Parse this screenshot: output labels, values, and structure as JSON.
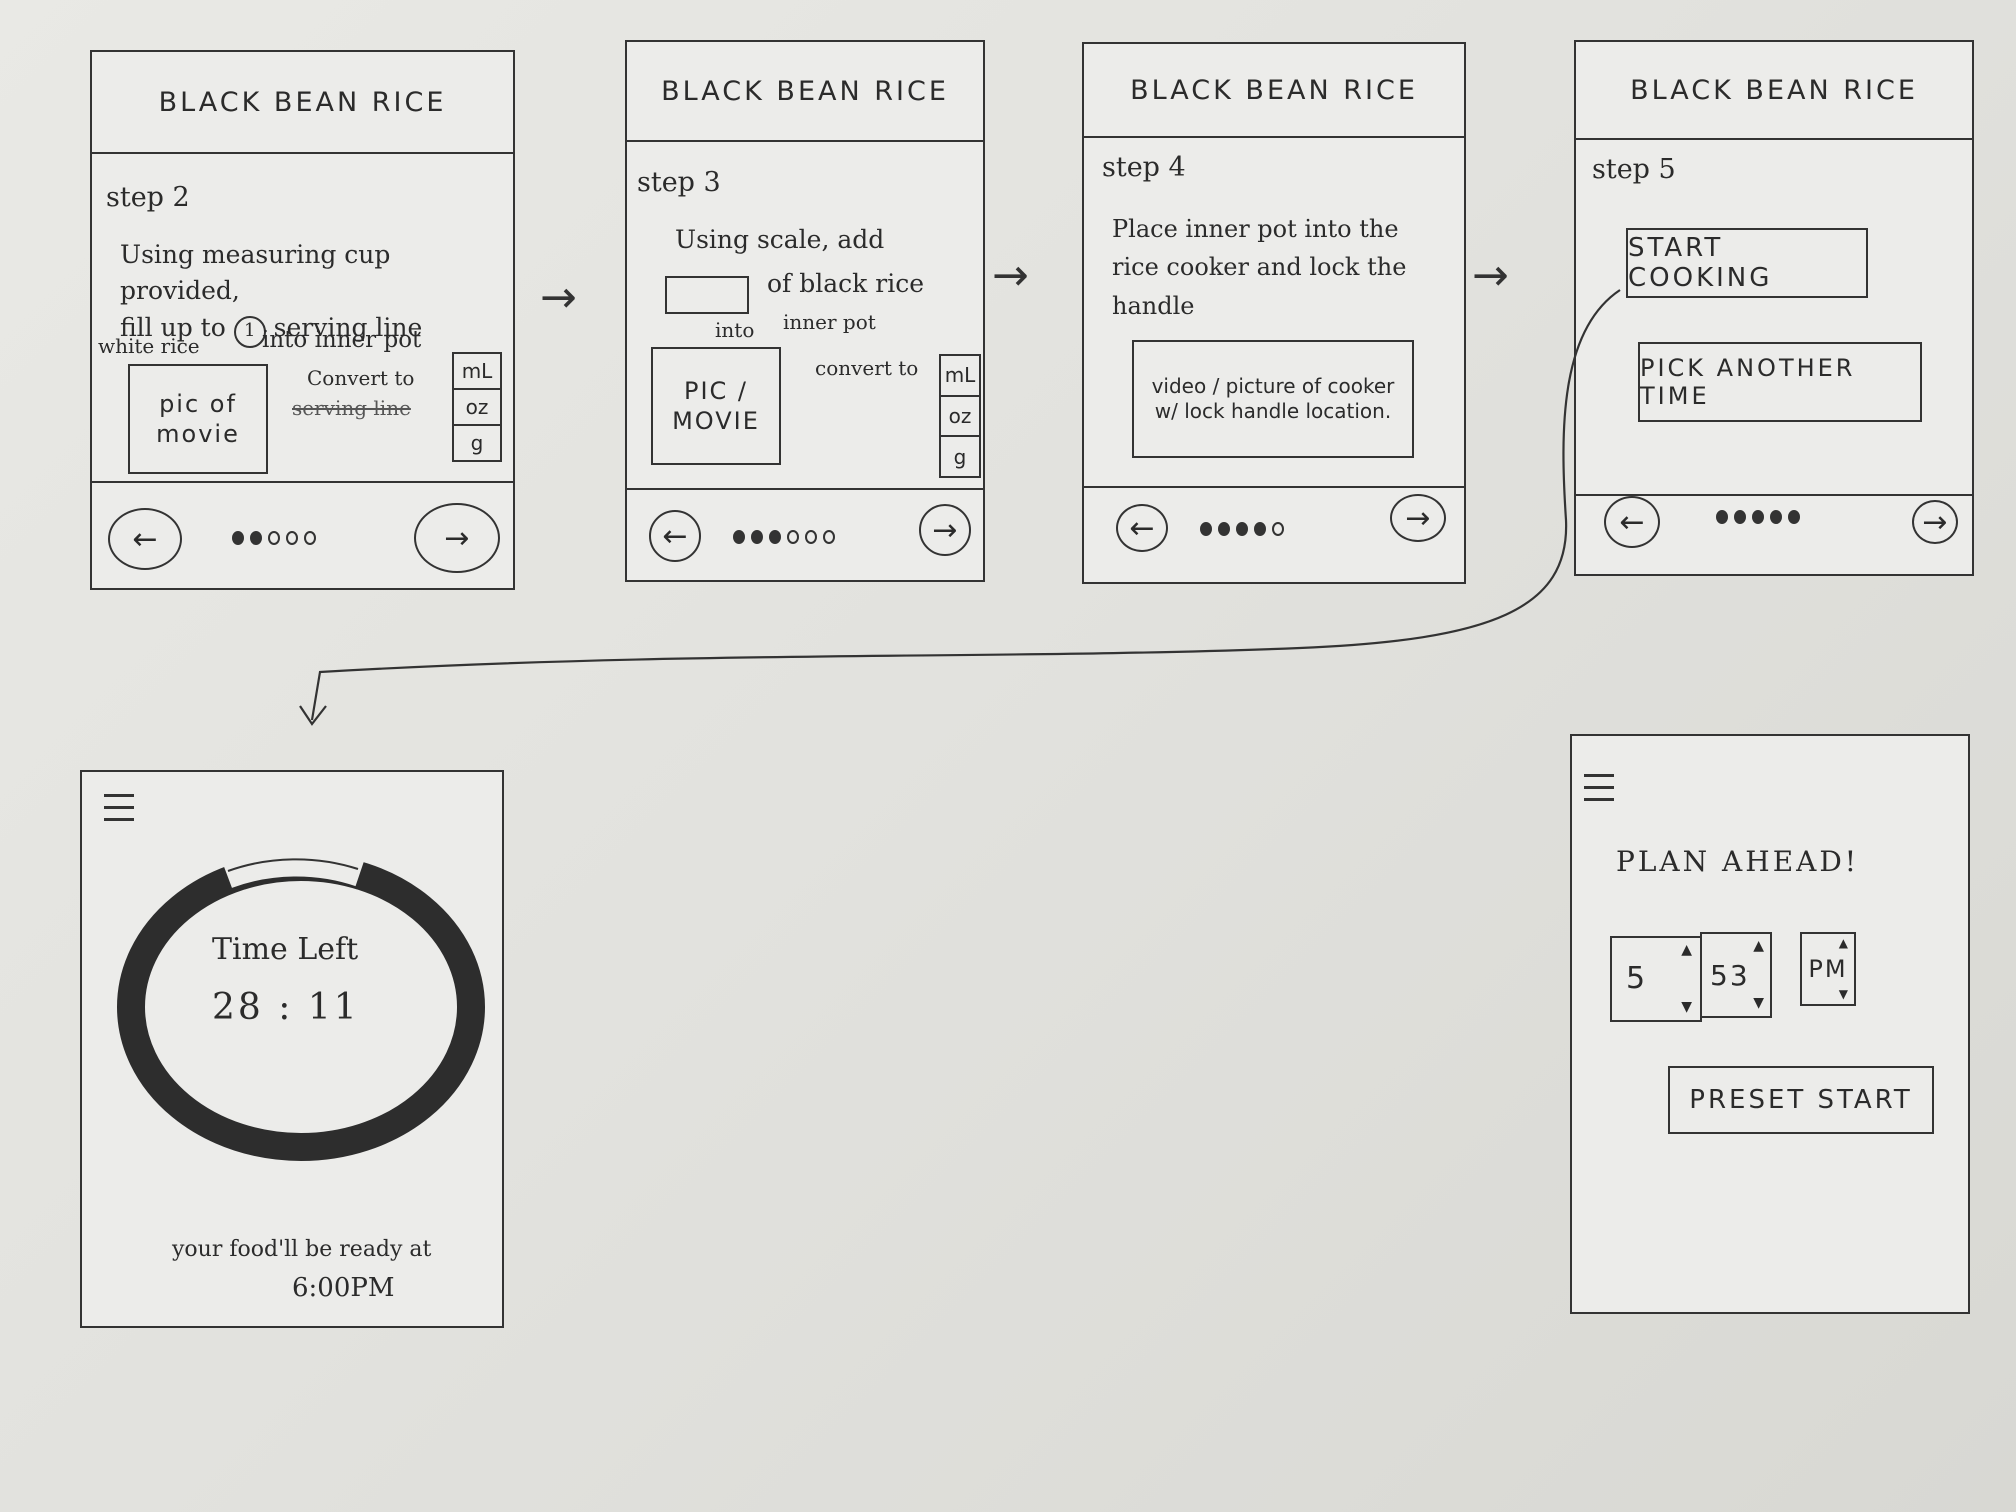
{
  "app_title": "BLACK BEAN RICE",
  "screens": {
    "step2": {
      "step_label": "step 2",
      "instruction_line1": "Using measuring cup provided,",
      "instruction_line2": "fill up to",
      "serving_number": "1",
      "instruction_line3": "serving line",
      "instruction_line4": "into inner pot",
      "caption": "white rice",
      "pic_label": "pic of movie",
      "convert_label": "Convert to",
      "strike_text": "serving line",
      "units": [
        "mL",
        "oz",
        "g"
      ],
      "dots_filled": 2,
      "dots_total": 5,
      "prev_label": "←",
      "next_label": "→"
    },
    "step3": {
      "step_label": "step 3",
      "instruction_line1": "Using scale, add",
      "instruction_line2": "of black rice",
      "under_box": "into",
      "instruction_line3": "inner pot",
      "pic_label": "PIC / MOVIE",
      "convert_label": "convert to",
      "units": [
        "mL",
        "oz",
        "g"
      ],
      "dots_filled": 3,
      "dots_total": 6,
      "prev_label": "←",
      "next_label": "→"
    },
    "step4": {
      "step_label": "step 4",
      "instruction_line1": "Place inner pot into the",
      "instruction_line2": "rice cooker and lock the",
      "instruction_line3": "handle",
      "media_label": "video / picture of cooker w/ lock handle location.",
      "dots_filled": 4,
      "dots_total": 5,
      "prev_label": "←",
      "next_label": "→"
    },
    "step5": {
      "step_label": "step 5",
      "start_cooking_label": "START COOKING",
      "pick_another_time_label": "PICK ANOTHER TIME",
      "dots_filled": 5,
      "dots_total": 5,
      "prev_label": "←",
      "next_label": "→"
    },
    "timer": {
      "time_left_label": "Time Left",
      "time_value": "28 : 11",
      "ready_text": "your food'll be ready at",
      "ready_time": "6:00PM"
    },
    "plan": {
      "title": "PLAN AHEAD!",
      "hour": "5",
      "minute": "53",
      "ampm": "PM",
      "preset_start_label": "PRESET START"
    }
  },
  "flow_arrows": [
    "→",
    "→",
    "→"
  ]
}
